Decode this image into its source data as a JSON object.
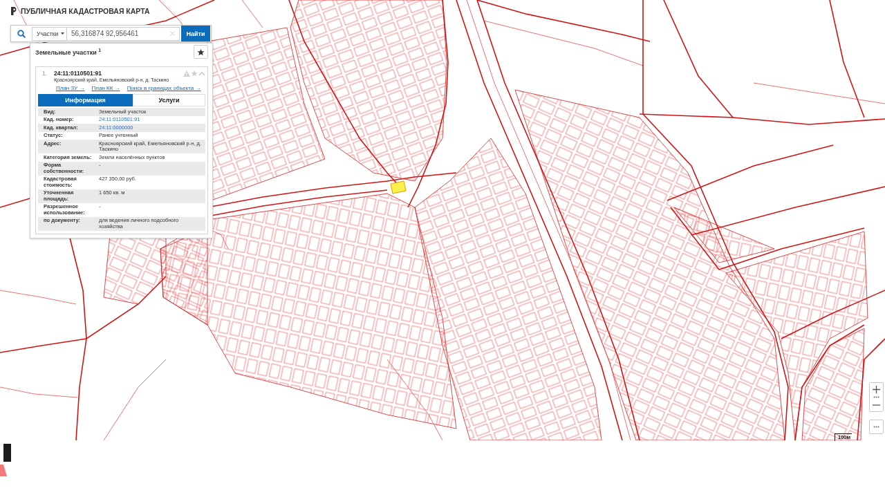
{
  "header": {
    "title": "ПУБЛИЧНАЯ КАДАСТРОВАЯ КАРТА"
  },
  "search": {
    "category": "Участки",
    "value": "56,316874 92,956461",
    "button": "Найти"
  },
  "results": {
    "title": "Земельные участки $^{1}$",
    "items": [
      {
        "number": "1.",
        "cadastral_number": "24:11:0110501:91",
        "address": "Красноярский край, Емельяновский р-н, д. Таскино",
        "links": [
          "План ЗУ →",
          "План КК →",
          "Поиск в границах объекта →"
        ],
        "tabs": [
          {
            "label": "Информация",
            "selected": true
          },
          {
            "label": "Услуги",
            "selected": false
          }
        ],
        "fields": [
          {
            "label": "Вид:",
            "value": "Земельный участок",
            "kind": "text"
          },
          {
            "label": "Кад. номер:",
            "value": "24:11:0110501:91",
            "kind": "link"
          },
          {
            "label": "Кад. квартал:",
            "value": "24:11:0000000",
            "kind": "link"
          },
          {
            "label": "Статус:",
            "value": "Ранее учтенный",
            "kind": "text"
          },
          {
            "label": "Адрес:",
            "value": "Красноярский край, Емельяновский р-н, д. Таскино",
            "kind": "text"
          },
          {
            "label": "Категория земель:",
            "value": "Земли населённых пунктов",
            "kind": "text"
          },
          {
            "label": "Форма собственности:",
            "value": "-",
            "kind": "text"
          },
          {
            "label": "Кадастровая стоимость:",
            "value": "427 350,00 руб.",
            "kind": "text"
          },
          {
            "label": "Уточненная площадь:",
            "value": "1 650 кв. м",
            "kind": "text"
          },
          {
            "label": "Разрешенное использование:",
            "value": "-",
            "kind": "text"
          },
          {
            "label": "по документу:",
            "value": "для ведения личного подсобного хозяйства",
            "kind": "text"
          }
        ]
      }
    ]
  },
  "scale": {
    "label": "100м"
  }
}
